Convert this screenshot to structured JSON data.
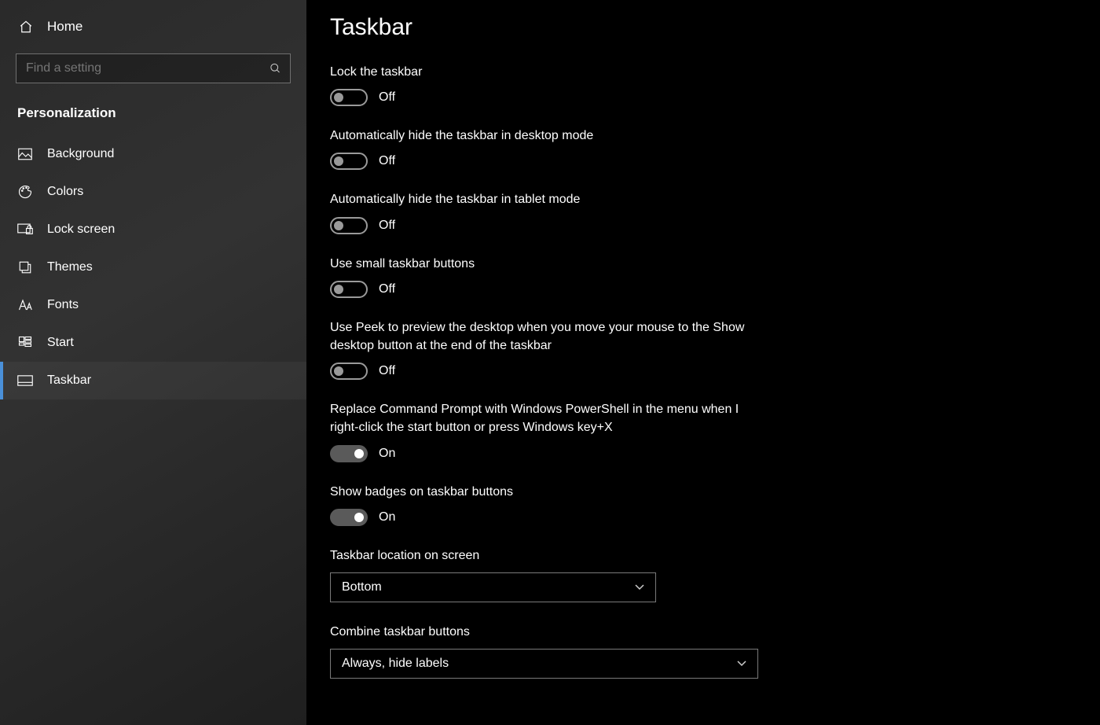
{
  "sidebar": {
    "home": "Home",
    "search_placeholder": "Find a setting",
    "section": "Personalization",
    "items": [
      {
        "label": "Background"
      },
      {
        "label": "Colors"
      },
      {
        "label": "Lock screen"
      },
      {
        "label": "Themes"
      },
      {
        "label": "Fonts"
      },
      {
        "label": "Start"
      },
      {
        "label": "Taskbar"
      }
    ]
  },
  "page": {
    "title": "Taskbar"
  },
  "toggle_states": {
    "on": "On",
    "off": "Off"
  },
  "settings": {
    "lock": {
      "label": "Lock the taskbar",
      "state": "off"
    },
    "autohide_desk": {
      "label": "Automatically hide the taskbar in desktop mode",
      "state": "off"
    },
    "autohide_tab": {
      "label": "Automatically hide the taskbar in tablet mode",
      "state": "off"
    },
    "small_buttons": {
      "label": "Use small taskbar buttons",
      "state": "off"
    },
    "peek": {
      "label": "Use Peek to preview the desktop when you move your mouse to the Show desktop button at the end of the taskbar",
      "state": "off"
    },
    "powershell": {
      "label": "Replace Command Prompt with Windows PowerShell in the menu when I right-click the start button or press Windows key+X",
      "state": "on"
    },
    "badges": {
      "label": "Show badges on taskbar buttons",
      "state": "on"
    },
    "location": {
      "label": "Taskbar location on screen",
      "value": "Bottom"
    },
    "combine": {
      "label": "Combine taskbar buttons",
      "value": "Always, hide labels"
    }
  }
}
